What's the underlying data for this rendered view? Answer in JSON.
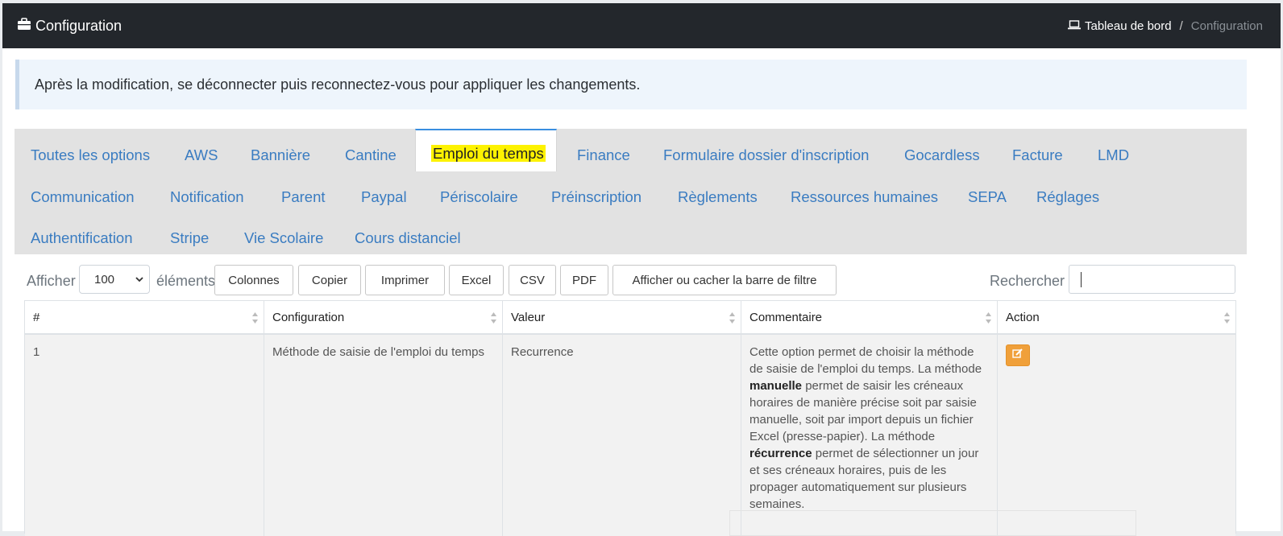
{
  "header": {
    "title": "Configuration",
    "breadcrumb": {
      "home": "Tableau de bord",
      "separator": "/",
      "current": "Configuration"
    }
  },
  "alert": {
    "text": "Après la modification, se déconnecter puis reconnectez-vous pour appliquer les changements."
  },
  "tabs": {
    "row1": [
      "Toutes les options",
      "AWS",
      "Bannière",
      "Cantine",
      "Emploi du temps",
      "Finance",
      "Formulaire dossier d'inscription",
      "Gocardless",
      "Facture",
      "LMD"
    ],
    "row2": [
      "Communication",
      "Notification",
      "Parent",
      "Paypal",
      "Périscolaire",
      "Préinscription",
      "Règlements",
      "Ressources humaines",
      "SEPA",
      "Réglages"
    ],
    "row3": [
      "Authentification",
      "Stripe",
      "Vie Scolaire",
      "Cours distanciel"
    ],
    "active": "Emploi du temps"
  },
  "toolbar": {
    "show_label": "Afficher",
    "page_size": "100",
    "elements_label": "éléments",
    "buttons": [
      "Colonnes",
      "Copier",
      "Imprimer",
      "Excel",
      "CSV",
      "PDF",
      "Afficher ou cacher la barre de filtre"
    ],
    "search_label": "Rechercher :",
    "search_value": ""
  },
  "table": {
    "headers": [
      "#",
      "Configuration",
      "Valeur",
      "Commentaire",
      "Action"
    ],
    "rows": [
      {
        "id": "1",
        "configuration": "Méthode de saisie de l'emploi du temps",
        "valeur": "Recurrence",
        "commentaire": {
          "p1": "Cette option permet de choisir la méthode de saisie de l'emploi du temps. La méthode ",
          "b1": "manuelle",
          "p2": " permet de saisir les créneaux horaires de manière précise soit par saisie manuelle, soit par import depuis un fichier Excel (presse-papier). La méthode ",
          "b2": "récurrence",
          "p3": " permet de sélectionner un jour et ses créneaux horaires, puis de les propager automatiquement sur plusieurs semaines."
        }
      }
    ]
  },
  "colors": {
    "topbar": "#23272c",
    "link": "#3a7cc1",
    "highlight": "#fdf201",
    "edit": "#f0a03a"
  }
}
